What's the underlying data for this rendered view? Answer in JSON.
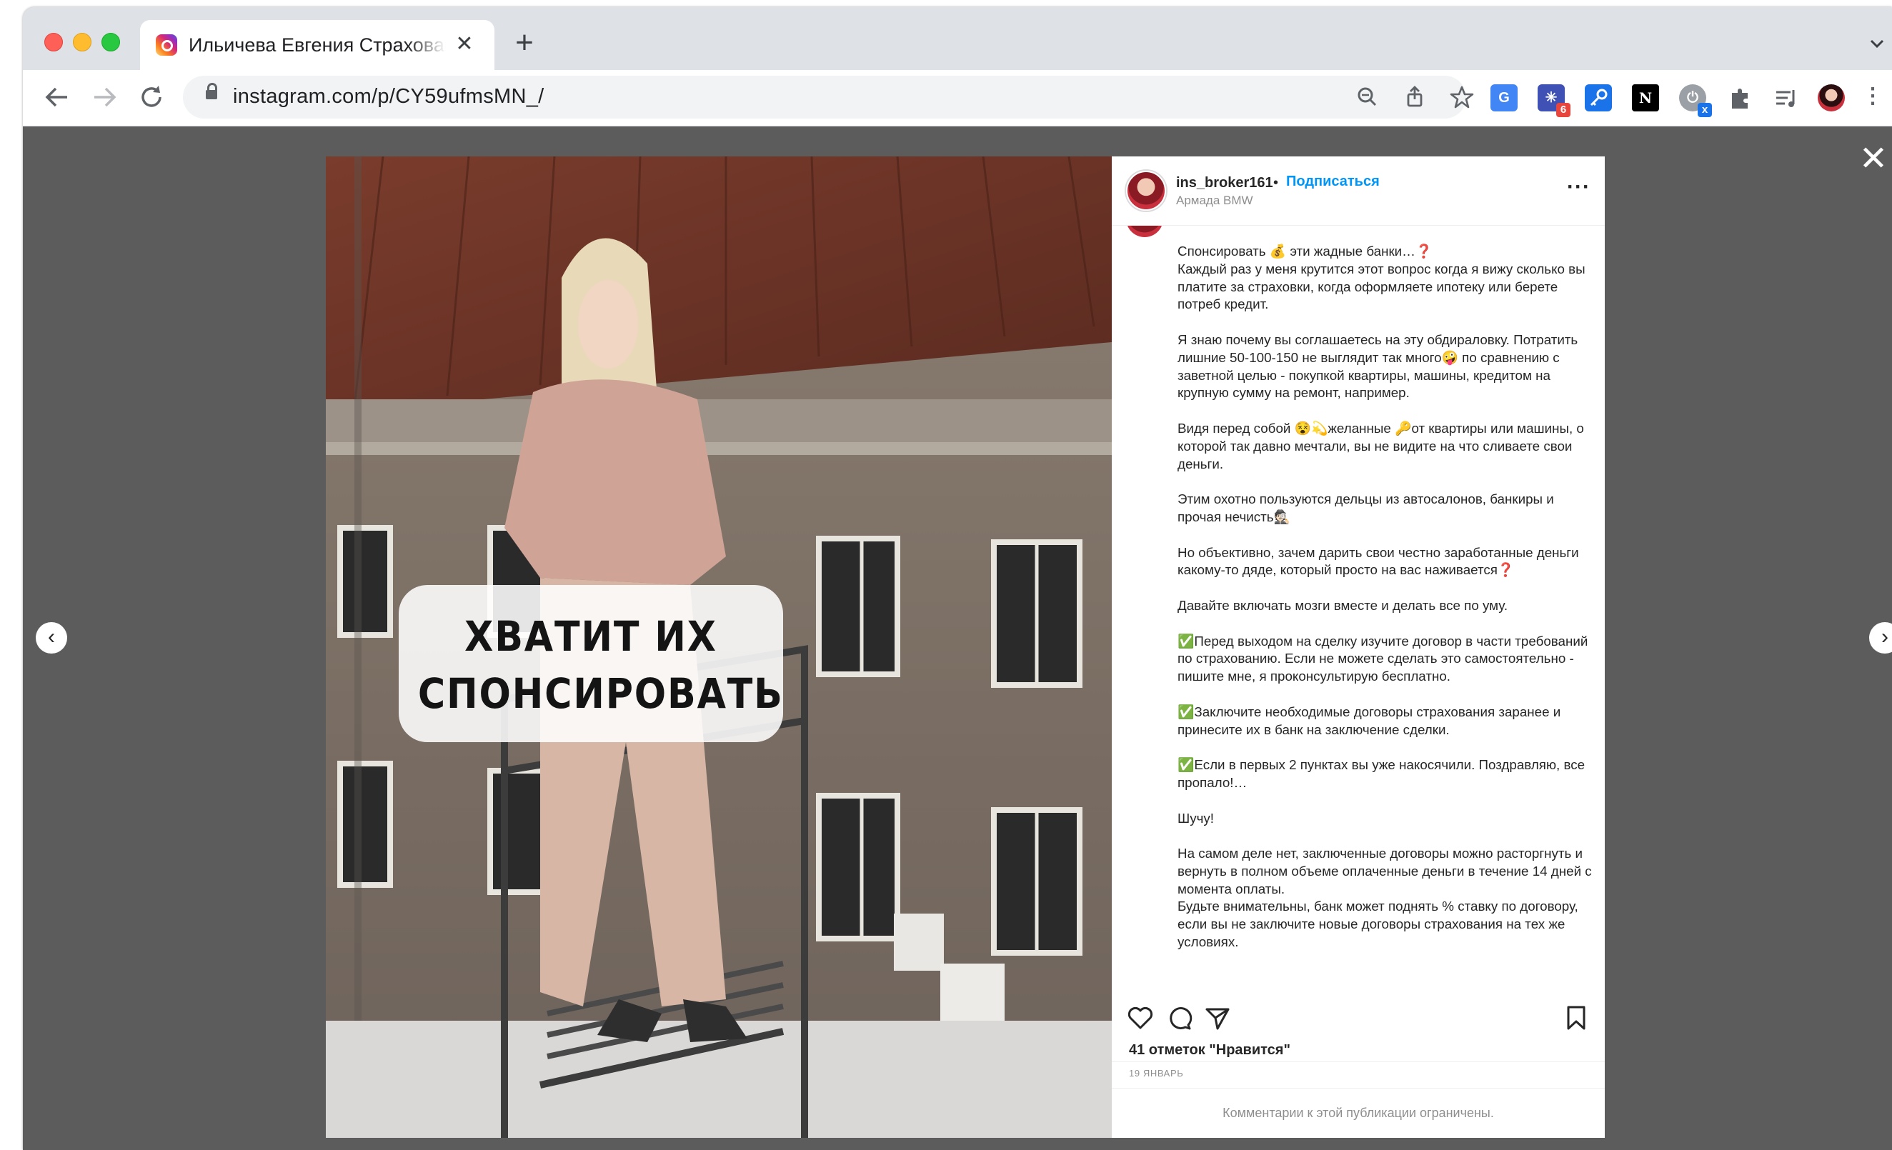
{
  "browser": {
    "tab_title": "Ильичева Евгения Страхование",
    "tab_close": "✕",
    "new_tab": "+",
    "url": "instagram.com/p/CY59ufmsMN_/",
    "extensions": [
      {
        "name": "translate",
        "glyph": "G",
        "color": "#4285f4"
      },
      {
        "name": "spark",
        "glyph": "✳",
        "color": "#3f51b5",
        "badge": "6",
        "badge_color": "#e8453c"
      },
      {
        "name": "key",
        "glyph": "🔑",
        "color": "#1a73e8"
      },
      {
        "name": "notion",
        "glyph": "N",
        "color": "#000000"
      },
      {
        "name": "power",
        "glyph": "⏻",
        "color": "#9aa0a6",
        "badge": "x",
        "badge_color": "#1a73e8"
      }
    ]
  },
  "post": {
    "username": "ins_broker161",
    "separator": "•",
    "follow_label": "Подписаться",
    "location": "Армада BMW",
    "image_text": [
      "ХВАТИТ ИХ",
      "СПОНСИРОВАТЬ"
    ],
    "caption": [
      "Спонсировать 💰 эти жадные банки…❓\nКаждый раз у меня крутится этот вопрос когда я вижу сколько вы платите за страховки, когда оформляете ипотеку или берете потреб кредит.",
      "Я знаю почему вы соглашаетесь на эту обдираловку. Потратить лишние 50-100-150 не выглядит так много🤪 по сравнению с заветной целью - покупкой квартиры, машины, кредитом на крупную сумму на ремонт, например.",
      "Видя перед собой 😵💫желанные 🔑от квартиры или машины, о которой так давно мечтали, вы не видите на что сливаете свои деньги.",
      "Этим охотно пользуются дельцы из автосалонов, банкиры и прочая нечисть🕵🏻",
      "Но объективно, зачем дарить свои честно заработанные деньги какому-то дяде, который просто на вас наживается❓",
      "Давайте включать мозги вместе и делать все по уму.",
      "✅Перед выходом на сделку изучите договор в части требований по страхованию. Если не можете сделать это самостоятельно - пишите мне, я проконсультирую бесплатно.",
      "✅Заключите необходимые договоры страхования заранее и принесите их в банк на заключение сделки.",
      "✅Если в первых 2 пунктах вы уже накосячили. Поздравляю, все пропало!…",
      "Шучу!",
      "На самом деле нет, заключенные договоры можно расторгнуть и вернуть в полном объеме оплаченные деньги в течение 14 дней с момента оплаты.\nБудьте внимательны, банк может поднять % ставку по договору, если вы не заключите новые договоры страхования на тех же условиях."
    ],
    "likes_text": "41 отметок \"Нравится\"",
    "date": "19 ЯНВАРЬ",
    "comments_restricted": "Комментарии к этой публикации ограничены."
  },
  "icons": {
    "close_modal": "✕",
    "prev": "‹",
    "next": "›",
    "more": "···"
  }
}
